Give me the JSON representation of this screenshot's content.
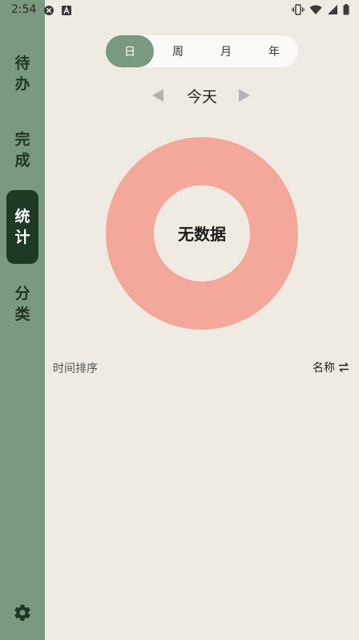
{
  "status_bar": {
    "time": "2:54",
    "left_icons": [
      "close-circle-icon",
      "text-a-icon"
    ],
    "right_icons": [
      "vibrate-icon",
      "wifi-icon",
      "signal-icon",
      "battery-icon"
    ]
  },
  "sidebar": {
    "items": [
      {
        "label": "待办",
        "chars": [
          "待",
          "办"
        ],
        "active": false
      },
      {
        "label": "完成",
        "chars": [
          "完",
          "成"
        ],
        "active": false
      },
      {
        "label": "统计",
        "chars": [
          "统",
          "计"
        ],
        "active": true
      },
      {
        "label": "分类",
        "chars": [
          "分",
          "类"
        ],
        "active": false
      }
    ],
    "settings_icon": "gear-icon"
  },
  "period_tabs": [
    {
      "label": "日",
      "active": true
    },
    {
      "label": "周",
      "active": false
    },
    {
      "label": "月",
      "active": false
    },
    {
      "label": "年",
      "active": false
    }
  ],
  "date_nav": {
    "label": "今天",
    "prev_icon": "triangle-left-icon",
    "next_icon": "triangle-right-icon"
  },
  "donut": {
    "center_text": "无数据",
    "ring_color": "#f4a79b"
  },
  "sort": {
    "left_label": "时间排序",
    "right_label": "名称",
    "right_icon": "swap-arrows-icon"
  },
  "colors": {
    "sidebar_bg": "#7a9a80",
    "sidebar_active": "#1d3a25",
    "page_bg": "#efebe2",
    "tab_active": "#7a9a80"
  }
}
